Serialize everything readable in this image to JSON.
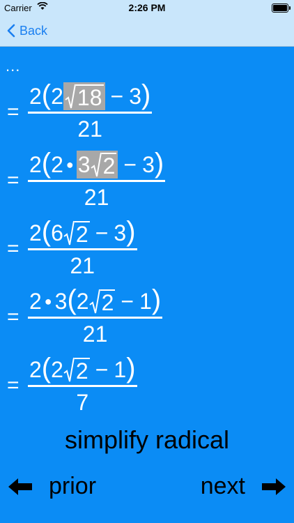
{
  "status": {
    "carrier": "Carrier",
    "time": "2:26 PM"
  },
  "nav": {
    "back_label": "Back"
  },
  "ellipsis": "...",
  "steps": [
    {
      "eq": "=",
      "den": "21",
      "n1": "2",
      "n2": "2",
      "rad": "18",
      "op": "−",
      "n3": "3"
    },
    {
      "eq": "=",
      "den": "21",
      "n1": "2",
      "n2": "2",
      "hl_coef": "3",
      "rad": "2",
      "op": "−",
      "n3": "3"
    },
    {
      "eq": "=",
      "den": "21",
      "n1": "2",
      "n2": "6",
      "rad": "2",
      "op": "−",
      "n3": "3"
    },
    {
      "eq": "=",
      "den": "21",
      "n1": "2",
      "n1b": "3",
      "n2": "2",
      "rad": "2",
      "op": "−",
      "n3": "1"
    },
    {
      "eq": "=",
      "den": "7",
      "n1": "2",
      "n2": "2",
      "rad": "2",
      "op": "−",
      "n3": "1"
    }
  ],
  "rule": "simplify radical",
  "footer": {
    "prior_label": "prior",
    "next_label": "next"
  }
}
